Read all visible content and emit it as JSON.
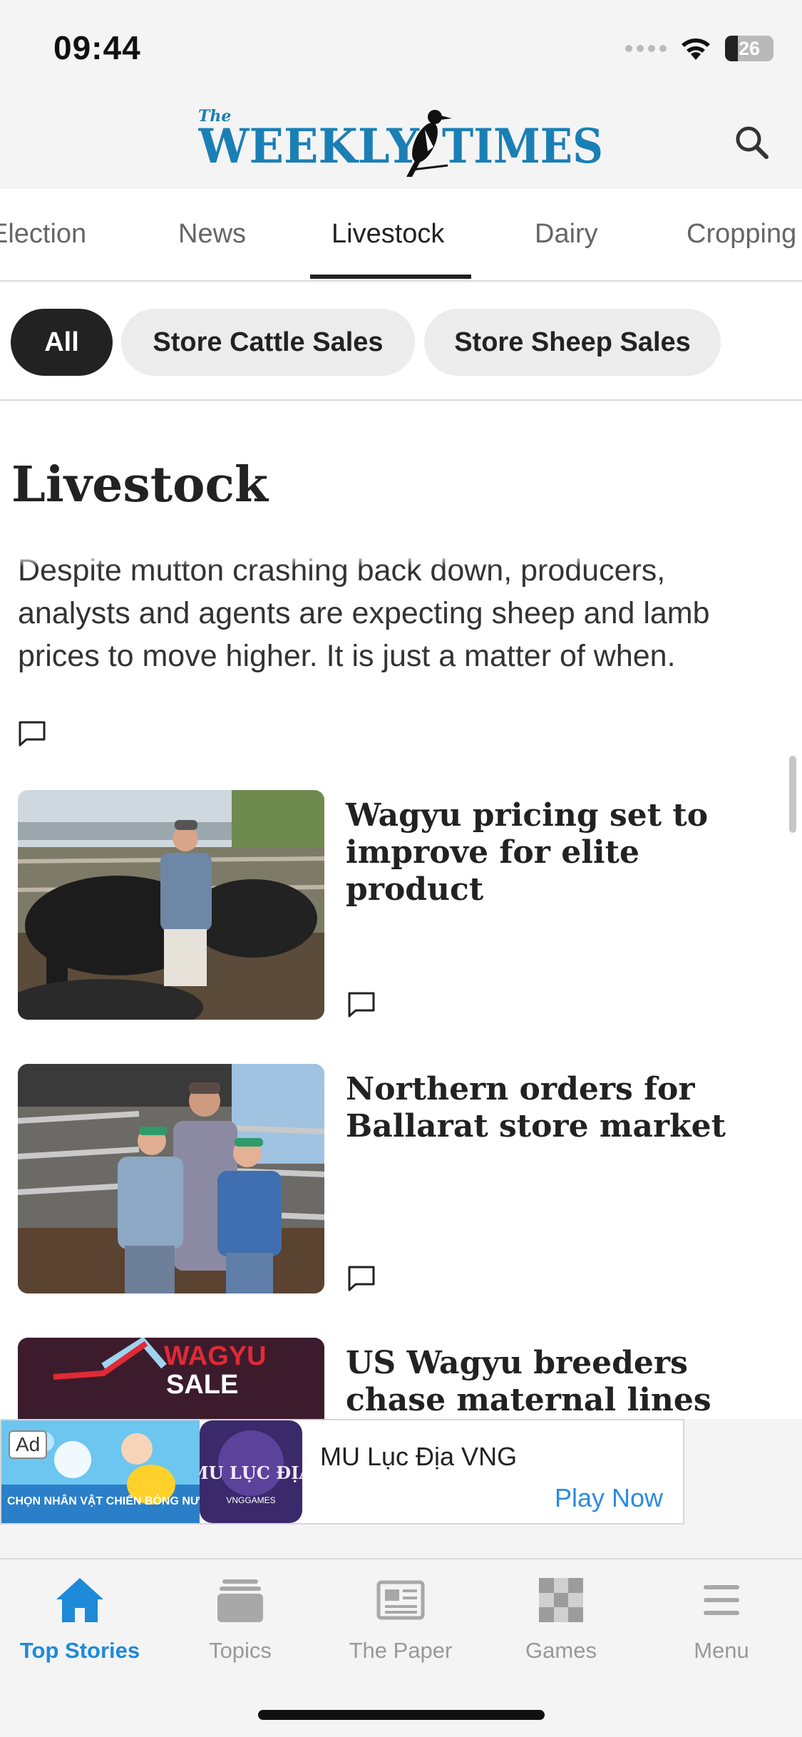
{
  "status_bar": {
    "time": "09:44",
    "battery": "26"
  },
  "header": {
    "logo_small": "The",
    "logo_left": "WEEKLY",
    "logo_right": "TIMES",
    "icons": {
      "search": "search-icon"
    }
  },
  "tabs": [
    {
      "label": "Election"
    },
    {
      "label": "News"
    },
    {
      "label": "Livestock",
      "active": true
    },
    {
      "label": "Dairy"
    },
    {
      "label": "Cropping"
    }
  ],
  "chips": [
    {
      "label": "All",
      "active": true
    },
    {
      "label": "Store Cattle Sales"
    },
    {
      "label": "Store Sheep Sales"
    }
  ],
  "section": {
    "title": "Livestock",
    "lead_text": "Despite mutton crashing back down, producers, analysts and agents are expecting sheep and lamb prices to move higher. It is just a matter of when."
  },
  "articles": [
    {
      "headline": "Wagyu pricing set to improve for elite product"
    },
    {
      "headline": "Northern orders for Ballarat store market"
    },
    {
      "headline": "US Wagyu breeders chase maternal lines",
      "thumb_text_line1": "WAGYU",
      "thumb_text_line2": "SALE"
    }
  ],
  "ad": {
    "badge": "Ad",
    "image_text": "CHỌN NHÂN VẬT CHIẾN BÓNG NƯỚC",
    "logo_text": "MU LỤC ĐỊA",
    "logo_sub": "VNGGAMES",
    "title": "MU Lục Địa VNG",
    "cta": "Play Now"
  },
  "bottom_nav": [
    {
      "label": "Top Stories",
      "icon": "home-icon",
      "active": true
    },
    {
      "label": "Topics",
      "icon": "topics-stack-icon"
    },
    {
      "label": "The Paper",
      "icon": "newspaper-icon"
    },
    {
      "label": "Games",
      "icon": "checkerboard-icon"
    },
    {
      "label": "Menu",
      "icon": "hamburger-menu-icon"
    }
  ],
  "colors": {
    "accent": "#1d8ad9",
    "logo_blue": "#1a7fb5",
    "chip_active": "#222222",
    "chip_inactive": "#ececec"
  }
}
